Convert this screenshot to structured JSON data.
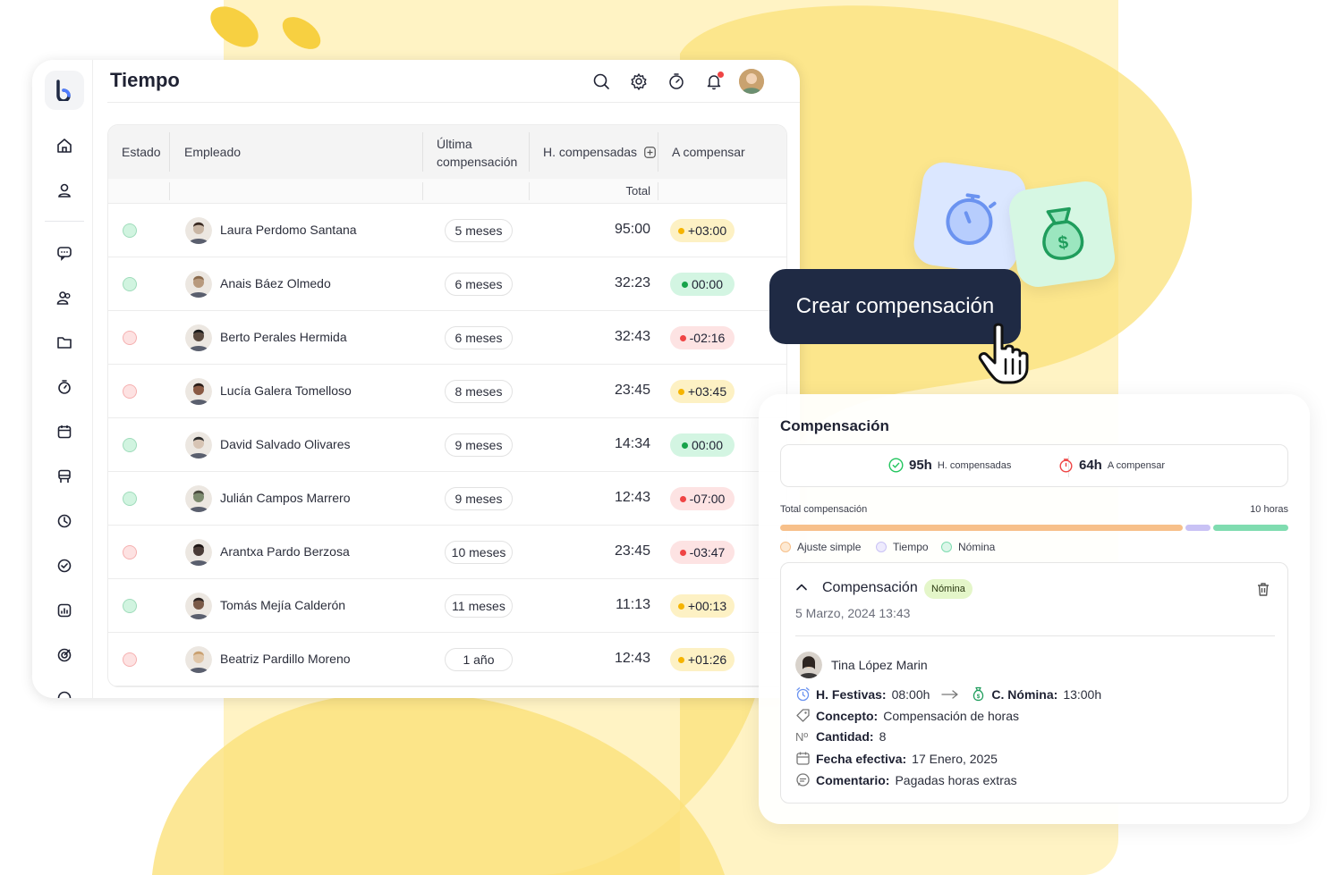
{
  "app": {
    "title": "Tiempo"
  },
  "table": {
    "headers": {
      "estado": "Estado",
      "empleado": "Empleado",
      "ultima_line1": "Última",
      "ultima_line2": "compensación",
      "h_compensadas": "H. compensadas",
      "a_compensar": "A compensar",
      "total": "Total"
    },
    "rows": [
      {
        "status": "green",
        "name": "Laura Perdomo Santana",
        "last": "5 meses",
        "total": "95:00",
        "balance": "+03:00",
        "balance_type": "yellow"
      },
      {
        "status": "green",
        "name": "Anais Báez Olmedo",
        "last": "6 meses",
        "total": "32:23",
        "balance": "00:00",
        "balance_type": "green"
      },
      {
        "status": "red",
        "name": "Berto Perales Hermida",
        "last": "6 meses",
        "total": "32:43",
        "balance": "-02:16",
        "balance_type": "red"
      },
      {
        "status": "red",
        "name": "Lucía Galera Tomelloso",
        "last": "8 meses",
        "total": "23:45",
        "balance": "+03:45",
        "balance_type": "yellow"
      },
      {
        "status": "green",
        "name": "David Salvado Olivares",
        "last": "9 meses",
        "total": "14:34",
        "balance": "00:00",
        "balance_type": "green"
      },
      {
        "status": "green",
        "name": "Julián Campos Marrero",
        "last": "9 meses",
        "total": "12:43",
        "balance": "-07:00",
        "balance_type": "red"
      },
      {
        "status": "red",
        "name": "Arantxa Pardo Berzosa",
        "last": "10 meses",
        "total": "23:45",
        "balance": "-03:47",
        "balance_type": "red"
      },
      {
        "status": "green",
        "name": "Tomás Mejía Calderón",
        "last": "11 meses",
        "total": "11:13",
        "balance": "+00:13",
        "balance_type": "yellow"
      },
      {
        "status": "red",
        "name": "Beatriz Pardillo Moreno",
        "last": "1 año",
        "total": "12:43",
        "balance": "+01:26",
        "balance_type": "yellow"
      }
    ]
  },
  "cta": {
    "label": "Crear compensación"
  },
  "panel": {
    "title": "Compensación",
    "summary": {
      "compensated_value": "95h",
      "compensated_label": "H. compensadas",
      "pending_value": "64h",
      "pending_label": "A compensar"
    },
    "total_label": "Total compensación",
    "total_hours": "10 horas",
    "distribution": {
      "ajuste_simple": 0.8,
      "tiempo": 0.05,
      "nomina": 0.15
    },
    "legend": [
      "Ajuste simple",
      "Tiempo",
      "Nómina"
    ],
    "detail": {
      "title": "Compensación",
      "tag": "Nómina",
      "date": "5 Marzo, 2024 13:43",
      "employee": "Tina López Marin",
      "h_festivas_label": "H. Festivas:",
      "h_festivas_value": "08:00h",
      "c_nomina_label": "C. Nómina:",
      "c_nomina_value": "13:00h",
      "concepto_label": "Concepto:",
      "concepto_value": "Compensación de horas",
      "cantidad_label": "Cantidad:",
      "cantidad_value": "8",
      "fecha_label": "Fecha efectiva:",
      "fecha_value": "17 Enero, 2025",
      "comentario_label": "Comentario:",
      "comentario_value": "Pagadas horas extras"
    }
  },
  "colors": {
    "accent_dark": "#1f2a44",
    "background_yellow": "#fff3c4",
    "blob_yellow": "#fbe17a",
    "bar_ajuste": "#f7c08a",
    "bar_tiempo": "#c9c2f5",
    "bar_nomina": "#7fdcb0"
  }
}
